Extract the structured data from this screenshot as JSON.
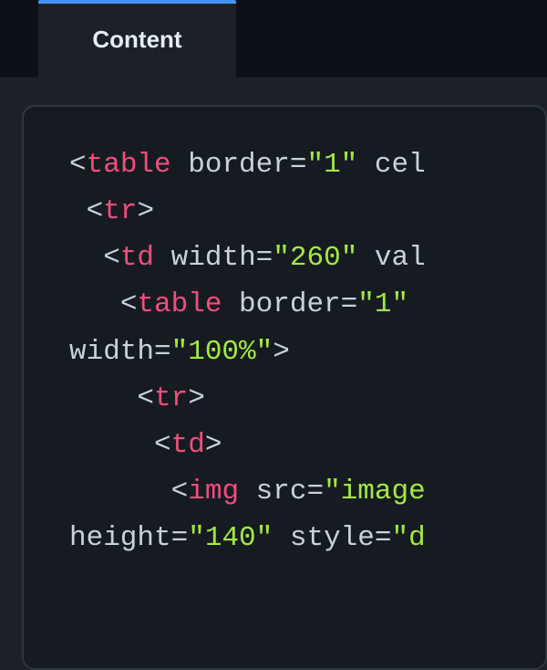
{
  "tabs": {
    "active_label": "Content"
  },
  "code": {
    "line1_tag": "table",
    "line1_attr1_name": "border",
    "line1_attr1_val": "\"1\"",
    "line1_attr2_prefix": " cel",
    "line2_tag": "tr",
    "line3_tag": "td",
    "line3_attr1_name": "width",
    "line3_attr1_val": "\"260\"",
    "line3_attr2_prefix": " val",
    "line4_tag": "table",
    "line4_attr1_name": "border",
    "line4_attr1_val": "\"1\"",
    "line4_attr2_prefix": " ",
    "line5_attr_name": "width",
    "line5_attr_val": "\"100%\"",
    "line5_close": ">",
    "line6_tag": "tr",
    "line7_tag": "td",
    "line8_tag": "img",
    "line8_attr1_name": "src",
    "line8_attr1_val": "\"image",
    "line9_attr1_name": "height",
    "line9_attr1_val": "\"140\"",
    "line9_attr2_name": "style",
    "line9_attr2_val": "\"d"
  }
}
